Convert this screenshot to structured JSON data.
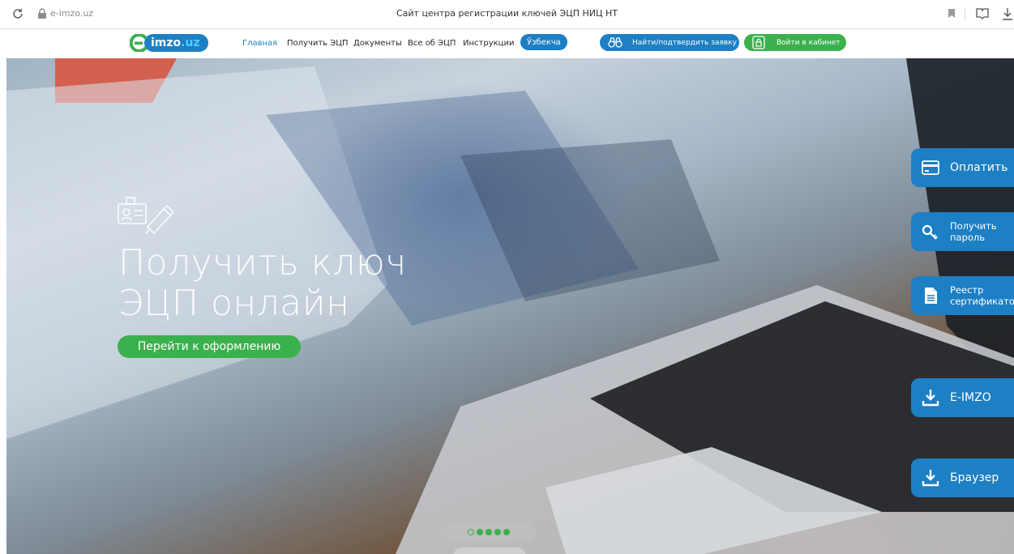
{
  "browser": {
    "url": "e-imzo.uz",
    "title": "Сайт центра регистрации ключей ЭЦП НИЦ НТ"
  },
  "logo": {
    "prefix": "imzo",
    "suffix": ".uz"
  },
  "nav": {
    "items": [
      {
        "label": "Главная",
        "active": true
      },
      {
        "label": "Получить ЭЦП"
      },
      {
        "label": "Документы"
      },
      {
        "label": "Все об ЭЦП"
      },
      {
        "label": "Инструкции"
      }
    ],
    "language": "Ўзбекча",
    "find_label": "Найти/подтвердить заявку",
    "login_label": "Войти в кабинет"
  },
  "hero": {
    "title_line1": "Получить ключ",
    "title_line2": "ЭЦП онлайн",
    "cta": "Перейти к оформлению"
  },
  "carousel": {
    "total": 5,
    "active_index": 0
  },
  "side_tabs": {
    "pay": "Оплатить",
    "password_line1": "Получить",
    "password_line2": "пароль",
    "registry_line1": "Реестр",
    "registry_line2": "сертификатов",
    "eimzo": "E-IMZO",
    "browser": "Браузер"
  },
  "colors": {
    "brand_blue": "#1d7fc4",
    "brand_green": "#3ab14c"
  }
}
